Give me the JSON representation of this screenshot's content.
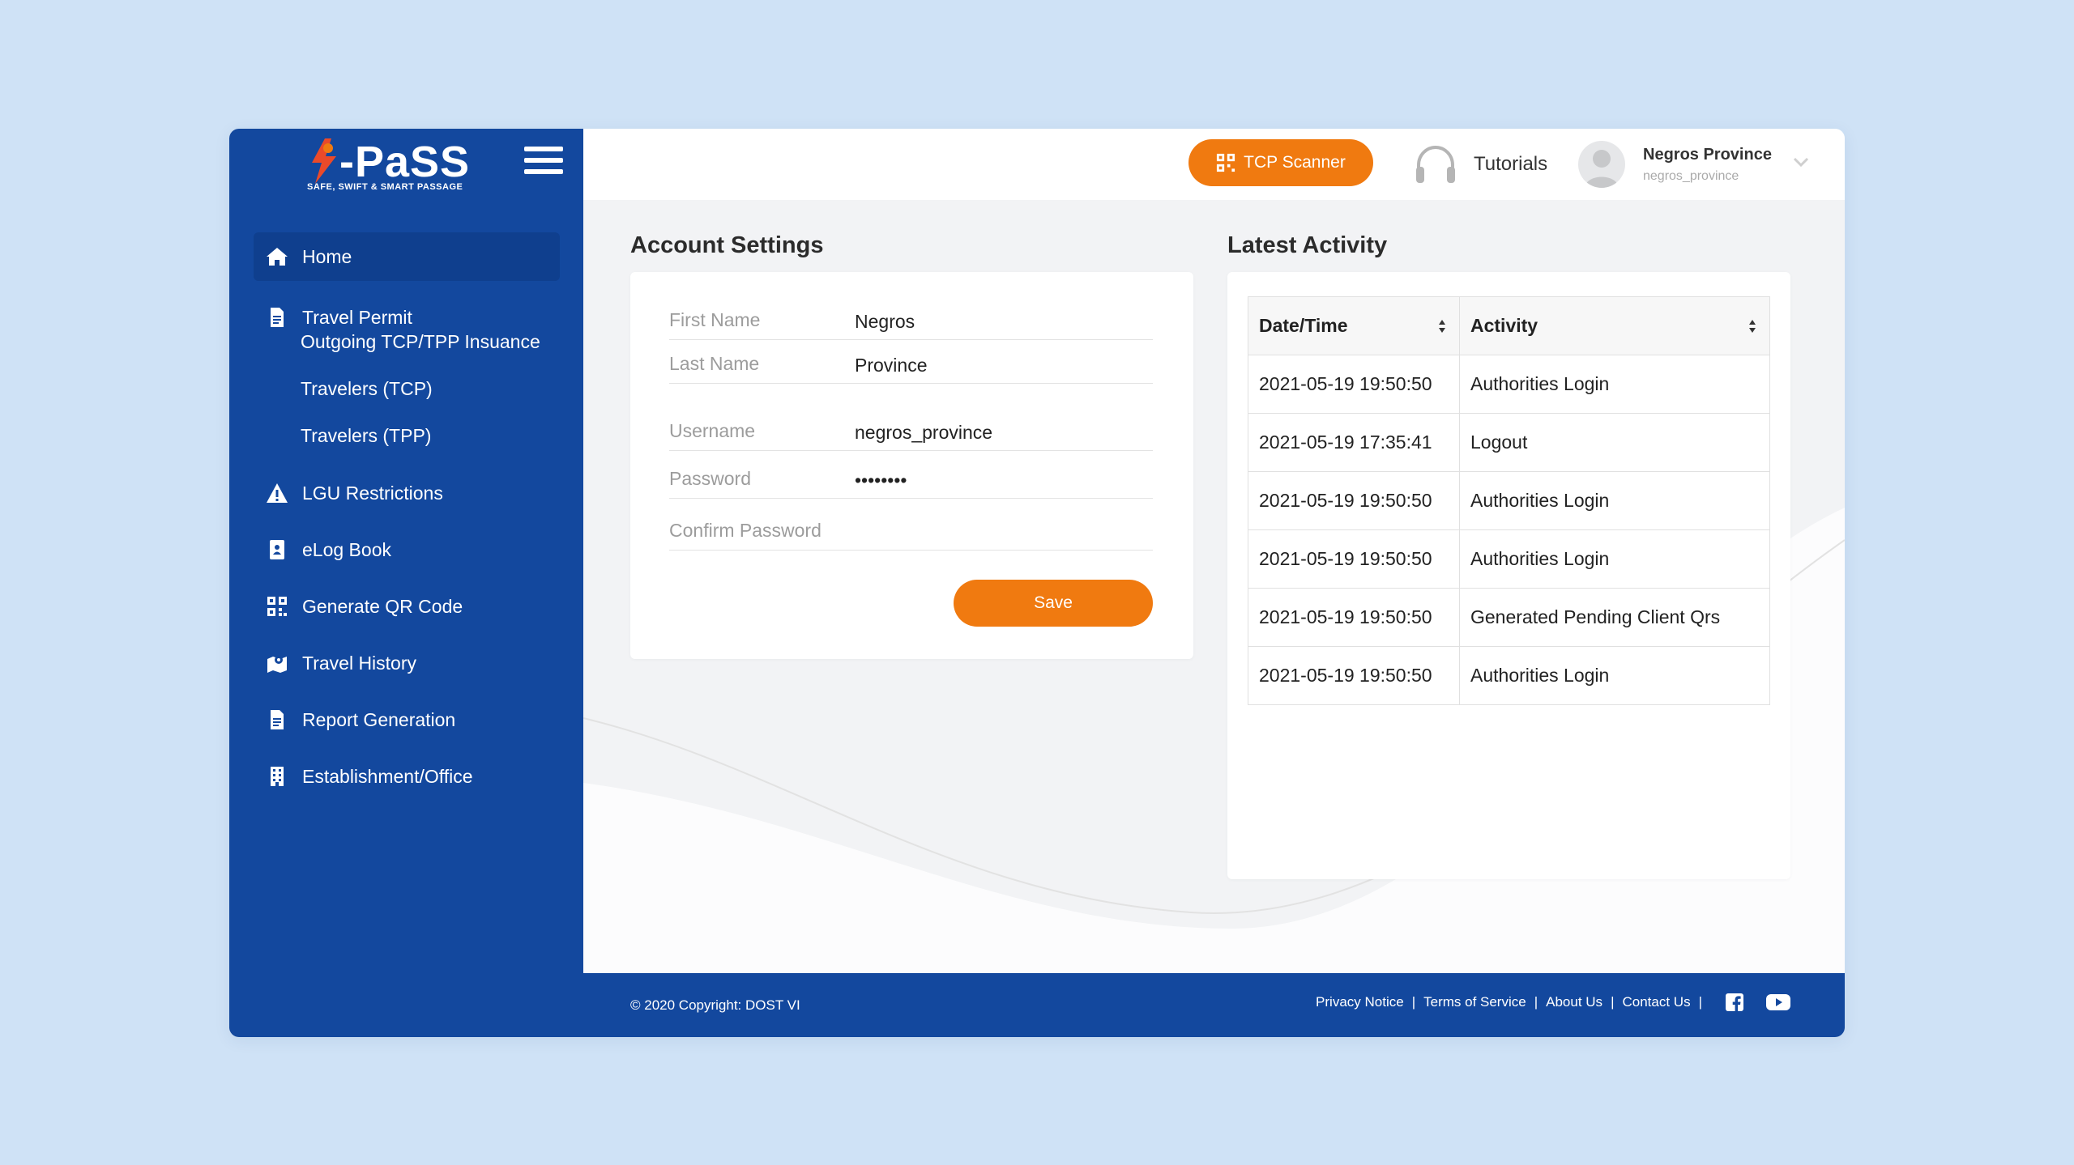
{
  "brand": {
    "name": "PaSS",
    "tagline": "SAFE, SWIFT & SMART PASSAGE"
  },
  "colors": {
    "primary": "#13489e",
    "accent": "#f07a10",
    "background": "#cfe2f6"
  },
  "sidebar": {
    "items": [
      {
        "label": "Home",
        "icon": "home-icon"
      },
      {
        "label": "Travel Permit",
        "icon": "document-icon"
      },
      {
        "label": "Outgoing TCP/TPP Insuance"
      },
      {
        "label": "Travelers (TCP)"
      },
      {
        "label": "Travelers (TPP)"
      },
      {
        "label": "LGU Restrictions",
        "icon": "warning-icon"
      },
      {
        "label": "eLog Book",
        "icon": "logbook-icon"
      },
      {
        "label": "Generate QR Code",
        "icon": "qr-code-icon"
      },
      {
        "label": "Travel History",
        "icon": "map-pin-icon"
      },
      {
        "label": "Report Generation",
        "icon": "document-icon"
      },
      {
        "label": "Establishment/Office",
        "icon": "building-icon"
      }
    ]
  },
  "header": {
    "tcp_scanner": "TCP Scanner",
    "tutorials": "Tutorials",
    "user_name": "Negros Province",
    "user_handle": "negros_province"
  },
  "account": {
    "title": "Account Settings",
    "fields": {
      "first_name_label": "First Name",
      "first_name_value": "Negros",
      "last_name_label": "Last Name",
      "last_name_value": "Province",
      "username_label": "Username",
      "username_value": "negros_province",
      "password_label": "Password",
      "password_value": "••••••••",
      "confirm_password_label": "Confirm Password",
      "confirm_password_value": ""
    },
    "save": "Save"
  },
  "activity": {
    "title": "Latest Activity",
    "columns": [
      "Date/Time",
      "Activity"
    ],
    "rows": [
      [
        "2021-05-19 19:50:50",
        "Authorities Login"
      ],
      [
        "2021-05-19 17:35:41",
        "Logout"
      ],
      [
        "2021-05-19 19:50:50",
        "Authorities Login"
      ],
      [
        "2021-05-19 19:50:50",
        "Authorities Login"
      ],
      [
        "2021-05-19 19:50:50",
        "Generated Pending Client Qrs"
      ],
      [
        "2021-05-19 19:50:50",
        "Authorities Login"
      ]
    ]
  },
  "footer": {
    "copyright": "© 2020 Copyright: DOST VI",
    "links": [
      "Privacy Notice",
      "Terms of Service",
      "About Us",
      "Contact Us"
    ]
  }
}
